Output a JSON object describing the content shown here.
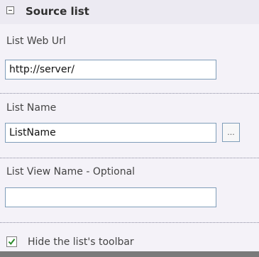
{
  "section": {
    "title": "Source list",
    "collapse_icon": "minus-square-icon"
  },
  "fields": {
    "list_web_url": {
      "label": "List Web Url",
      "value": "http://server/"
    },
    "list_name": {
      "label": "List Name",
      "value": "ListName",
      "browse_label": "..."
    },
    "list_view_name": {
      "label": "List View Name - Optional",
      "value": ""
    }
  },
  "options": {
    "hide_toolbar": {
      "label": "Hide the list's toolbar",
      "checked": true
    }
  }
}
